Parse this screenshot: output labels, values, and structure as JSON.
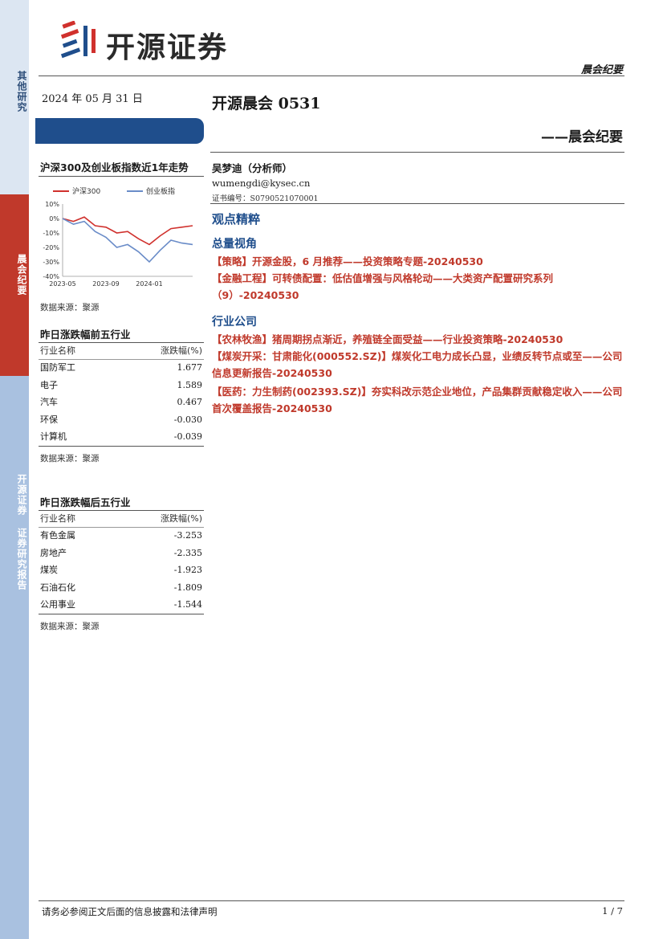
{
  "side": {
    "top_label": "其他研究",
    "mid_label": "晨会纪要",
    "bottom_label": "开源证券 证券研究报告"
  },
  "header": {
    "company": "开源证券",
    "tag": "晨会纪要"
  },
  "doc": {
    "date": "2024 年 05 月 31 日",
    "title": "开源晨会 0531",
    "subtitle": "——晨会纪要",
    "analyst": "吴梦迪（分析师）",
    "email": "wumengdi@kysec.cn",
    "cert": "证书编号：S0790521070001"
  },
  "chart_panel": {
    "title": "沪深300及创业板指数近1年走势",
    "source": "数据来源：聚源"
  },
  "chart_data": {
    "type": "line",
    "x": [
      "2023-05",
      "2023-06",
      "2023-07",
      "2023-08",
      "2023-09",
      "2023-10",
      "2023-11",
      "2023-12",
      "2024-01",
      "2024-02",
      "2024-03",
      "2024-04",
      "2024-05"
    ],
    "x_tick_labels": [
      "2023-05",
      "2023-09",
      "2024-01"
    ],
    "y_tick_labels": [
      "10%",
      "0%",
      "-10%",
      "-20%",
      "-30%",
      "-40%"
    ],
    "ylim": [
      -40,
      10
    ],
    "series": [
      {
        "name": "沪深300",
        "color": "#d0312d",
        "values": [
          0,
          -2,
          1,
          -5,
          -6,
          -10,
          -9,
          -14,
          -18,
          -12,
          -7,
          -6,
          -5
        ]
      },
      {
        "name": "创业板指",
        "color": "#6a8cc8",
        "values": [
          0,
          -4,
          -2,
          -9,
          -13,
          -20,
          -18,
          -23,
          -30,
          -22,
          -15,
          -17,
          -18
        ]
      }
    ],
    "legend_position": "top"
  },
  "top5": {
    "title": "昨日涨跌幅前五行业",
    "col_name": "行业名称",
    "col_value": "涨跌幅(%)",
    "rows": [
      {
        "name": "国防军工",
        "value": "1.677"
      },
      {
        "name": "电子",
        "value": "1.589"
      },
      {
        "name": "汽车",
        "value": "0.467"
      },
      {
        "name": "环保",
        "value": "-0.030"
      },
      {
        "name": "计算机",
        "value": "-0.039"
      }
    ],
    "source": "数据来源：聚源"
  },
  "bottom5": {
    "title": "昨日涨跌幅后五行业",
    "col_name": "行业名称",
    "col_value": "涨跌幅(%)",
    "rows": [
      {
        "name": "有色金属",
        "value": "-3.253"
      },
      {
        "name": "房地产",
        "value": "-2.335"
      },
      {
        "name": "煤炭",
        "value": "-1.923"
      },
      {
        "name": "石油石化",
        "value": "-1.809"
      },
      {
        "name": "公用事业",
        "value": "-1.544"
      }
    ],
    "source": "数据来源：聚源"
  },
  "content": {
    "heading": "观点精粹",
    "macro_heading": "总量视角",
    "macro_items": [
      "【策略】开源金股，6 月推荐——投资策略专题-20240530",
      "【金融工程】可转债配置：低估值增强与风格轮动——大类资产配置研究系列（9）-20240530"
    ],
    "industry_heading": "行业公司",
    "industry_items": [
      "【农林牧渔】猪周期拐点渐近，养殖链全面受益——行业投资策略-20240530",
      "【煤炭开采：甘肃能化(000552.SZ)】煤炭化工电力成长凸显，业绩反转节点或至——公司信息更新报告-20240530",
      "【医药：力生制药(002393.SZ)】夯实科改示范企业地位，产品集群贡献稳定收入——公司首次覆盖报告-20240530"
    ]
  },
  "footer": {
    "disclaimer": "请务必参阅正文后面的信息披露和法律声明",
    "page": "1 / 7"
  }
}
